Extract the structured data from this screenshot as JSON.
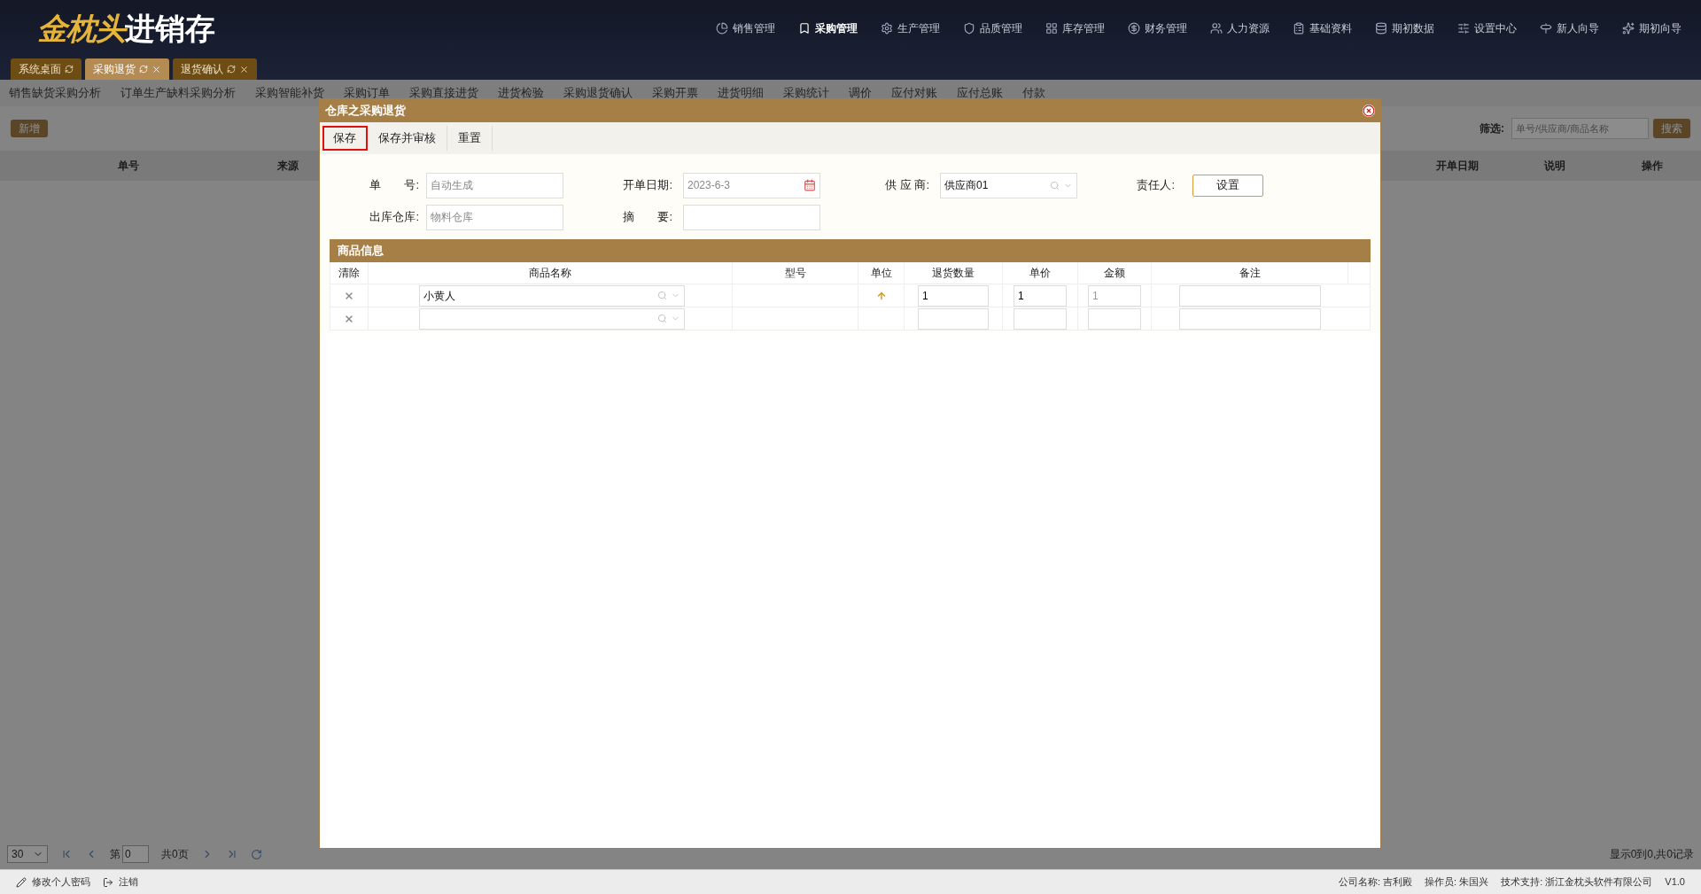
{
  "logo": {
    "brand": "金枕头",
    "product": "进销存"
  },
  "nav": [
    {
      "label": "销售管理",
      "selected": false
    },
    {
      "label": "采购管理",
      "selected": true
    },
    {
      "label": "生产管理",
      "selected": false
    },
    {
      "label": "品质管理",
      "selected": false
    },
    {
      "label": "库存管理",
      "selected": false
    },
    {
      "label": "财务管理",
      "selected": false
    },
    {
      "label": "人力资源",
      "selected": false
    },
    {
      "label": "基础资料",
      "selected": false
    },
    {
      "label": "期初数据",
      "selected": false
    },
    {
      "label": "设置中心",
      "selected": false
    },
    {
      "label": "新人向导",
      "selected": false
    },
    {
      "label": "期初向导",
      "selected": false
    }
  ],
  "tabs": [
    {
      "label": "系统桌面",
      "selected": false,
      "closable": false
    },
    {
      "label": "采购退货",
      "selected": true,
      "closable": true
    },
    {
      "label": "退货确认",
      "selected": false,
      "closable": true
    }
  ],
  "subnav": [
    "销售缺货采购分析",
    "订单生产缺料采购分析",
    "采购智能补货",
    "采购订单",
    "采购直接进货",
    "进货检验",
    "采购退货确认",
    "采购开票",
    "进货明细",
    "采购统计",
    "调价",
    "应付对账",
    "应付总账",
    "付款"
  ],
  "toolbar": {
    "add_button": "新增",
    "filter_label": "筛选:",
    "filter_placeholder": "单号/供应商/商品名称",
    "search_button": "搜索"
  },
  "list_columns_left": [
    "单号",
    "来源"
  ],
  "list_columns_right": [
    "开单日期",
    "说明",
    "操作"
  ],
  "pager": {
    "page_size": "30",
    "page_prefix": "第",
    "page": "0",
    "total_pages": "共0页",
    "summary": "显示0到0,共0记录"
  },
  "dialog": {
    "title": "仓库之采购退货",
    "buttons": [
      {
        "label": "保存",
        "highlighted": true
      },
      {
        "label": "保存并审核",
        "highlighted": false
      },
      {
        "label": "重置",
        "highlighted": false
      }
    ],
    "form": {
      "number_label": "单　　号:",
      "number_value": "自动生成",
      "date_label": "开单日期:",
      "date_value": "2023-6-3",
      "supplier_label": "供 应 商:",
      "supplier_value": "供应商01",
      "owner_label": "责任人:",
      "owner_button": "设置",
      "warehouse_label": "出库仓库:",
      "warehouse_value": "物料仓库",
      "memo_label": "摘　　要:"
    },
    "section_title": "商品信息",
    "columns": [
      "清除",
      "商品名称",
      "型号",
      "单位",
      "退货数量",
      "单价",
      "金额",
      "备注"
    ],
    "rows": [
      {
        "name": "小黄人",
        "unit_marker": true,
        "quantity": "1",
        "price": "1",
        "amount": "1"
      },
      {
        "unit_marker": false
      }
    ]
  },
  "status_bar": {
    "change_password": "修改个人密码",
    "logout": "注销",
    "company": "公司名称: 吉利殿",
    "operator": "操作员: 朱国兴",
    "support": "技术支持: 浙江金枕头软件有限公司",
    "version": "V1.0"
  }
}
